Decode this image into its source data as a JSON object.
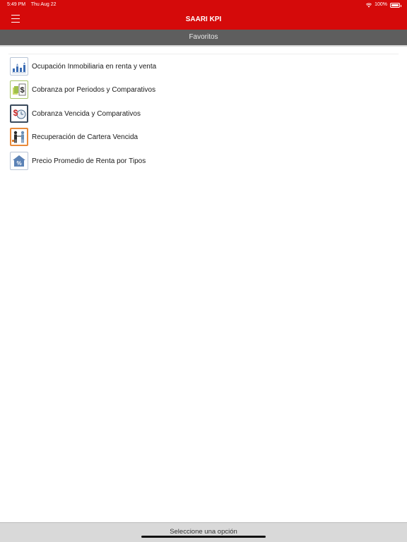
{
  "status_bar": {
    "time": "5:49 PM",
    "date": "Thu Aug 22",
    "battery": "100%"
  },
  "navbar": {
    "title": "SAARI KPI",
    "menu_icon": "hamburger-icon"
  },
  "subheader": {
    "title": "Favoritos"
  },
  "favorites": [
    {
      "label": "Ocupación Inmobiliaria en renta y venta",
      "icon": "buildings-occupancy-icon"
    },
    {
      "label": "Cobranza por Periodos y Comparativos",
      "icon": "money-collection-icon"
    },
    {
      "label": "Cobranza Vencida y Comparativos",
      "icon": "overdue-collection-icon"
    },
    {
      "label": "Recuperación de Cartera Vencida",
      "icon": "handshake-recovery-icon"
    },
    {
      "label": "Precio Promedio de Renta por Tipos",
      "icon": "house-percent-icon"
    }
  ],
  "footer": {
    "text": "Seleccione una opción"
  },
  "colors": {
    "brand_red": "#d50a0a",
    "subheader_gray": "#5e5e5e",
    "footer_gray": "#d9d9d9"
  }
}
